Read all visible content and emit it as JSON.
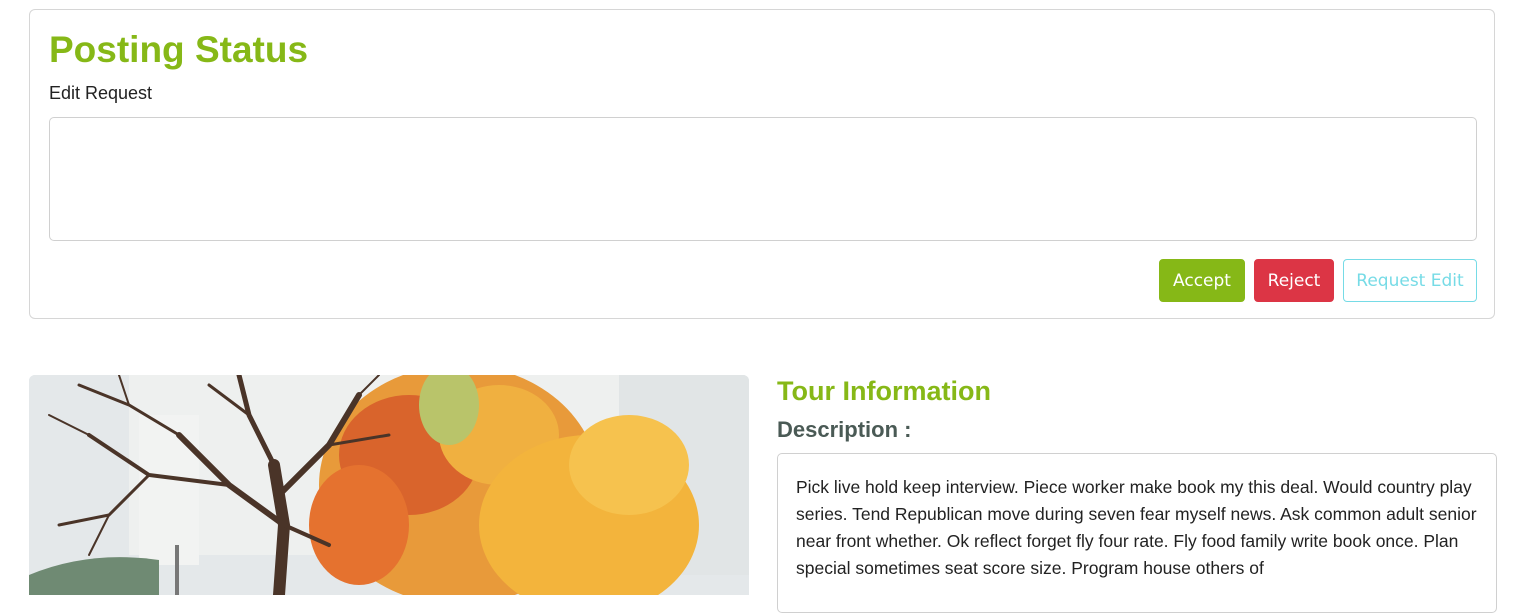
{
  "posting_status": {
    "title": "Posting Status",
    "edit_request_label": "Edit Request",
    "edit_request_value": "",
    "buttons": {
      "accept": "Accept",
      "reject": "Reject",
      "request_edit": "Request Edit"
    }
  },
  "tour": {
    "title": "Tour Information",
    "description_label": "Description :",
    "description": "Pick live hold keep interview. Piece worker make book my this deal. Would country play series. Tend Republican move during seven fear myself news. Ask common adult senior near front whether. Ok reflect forget fly four rate. Fly food family write book once. Plan special sometimes seat score size. Program house others of"
  },
  "colors": {
    "brand": "#86b817",
    "danger": "#dc3545",
    "info": "#76dbe6"
  }
}
